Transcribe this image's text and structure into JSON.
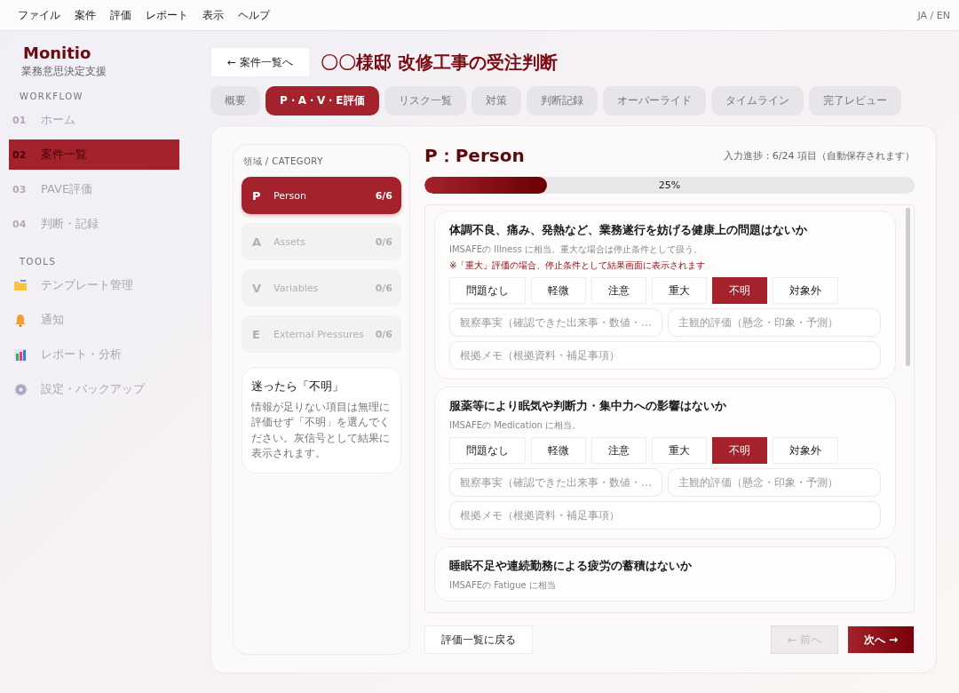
{
  "menu": [
    "ファイル",
    "案件",
    "評価",
    "レポート",
    "表示",
    "ヘルプ"
  ],
  "language_switch": "JA / EN",
  "sidebar": {
    "brand": "Monitio",
    "subtitle": "業務意思決定支援",
    "sections": [
      {
        "title": "WORKFLOW",
        "items": [
          {
            "kind": "numbered",
            "number": "01",
            "label": "ホーム",
            "selected": false
          },
          {
            "kind": "numbered",
            "number": "02",
            "label": "案件一覧",
            "selected": true
          },
          {
            "kind": "numbered",
            "number": "03",
            "label": "PAVE評価",
            "selected": false
          },
          {
            "kind": "numbered",
            "number": "04",
            "label": "判断・記録",
            "selected": false
          }
        ]
      },
      {
        "title": "TOOLS",
        "items": [
          {
            "kind": "icon",
            "label": "テンプレート管理",
            "selected": false
          },
          {
            "kind": "icon",
            "label": "通知",
            "selected": false
          },
          {
            "kind": "icon",
            "label": "レポート・分析",
            "selected": false
          },
          {
            "kind": "icon",
            "label": "設定・バックアップ",
            "selected": false
          }
        ]
      }
    ]
  },
  "back_button": "← 案件一覧へ",
  "title": "〇〇様邸 改修工事の受注判断",
  "tabs": [
    {
      "label": "概要",
      "selected": false
    },
    {
      "label": "P・A・V・E評価",
      "selected": true
    },
    {
      "label": "リスク一覧",
      "selected": false
    },
    {
      "label": "対策",
      "selected": false
    },
    {
      "label": "判断記録",
      "selected": false
    },
    {
      "label": "オーバーライド",
      "selected": false
    },
    {
      "label": "タイムライン",
      "selected": false
    },
    {
      "label": "完了レビュー",
      "selected": false
    }
  ],
  "category_heading": "領域 / CATEGORY",
  "categories": [
    {
      "letter": "P",
      "name": "Person",
      "count": "6/6",
      "selected": true
    },
    {
      "letter": "A",
      "name": "Assets",
      "count": "0/6",
      "selected": false
    },
    {
      "letter": "V",
      "name": "Variables",
      "count": "0/6",
      "selected": false
    },
    {
      "letter": "E",
      "name": "External Pressures",
      "count": "0/6",
      "selected": false
    }
  ],
  "hint": {
    "title": "迷ったら「不明」",
    "text": "情報が足りない項目は無理に評価せず「不明」を選んでください。灰信号として結果に表示されます。"
  },
  "section_title": "P：Person",
  "progress_text": "入力進捗：6/24 項目（自動保存されます）",
  "progress": {
    "level": 0.25,
    "label": "25%"
  },
  "questions": [
    {
      "title": "体調不良、痛み、発熱など、業務遂行を妨げる健康上の問題はないか",
      "note": "IMSAFEの Illness に相当。重大な場合は停止条件として扱う。",
      "warning": "※「重大」評価の場合、停止条件として結果画面に表示されます",
      "options": [
        {
          "label": "問題なし",
          "selected": false
        },
        {
          "label": "軽微",
          "selected": false
        },
        {
          "label": "注意",
          "selected": false
        },
        {
          "label": "重大",
          "selected": false
        },
        {
          "label": "不明",
          "selected": true
        },
        {
          "label": "対象外",
          "selected": false
        }
      ],
      "fields": [
        {
          "placeholder": "観察事実（確認できた出来事・数値・…"
        },
        {
          "placeholder": "主観的評価（懸念・印象・予測）"
        },
        {
          "placeholder": "根拠メモ（根拠資料・補足事項）"
        }
      ]
    },
    {
      "title": "服薬等により眠気や判断力・集中力への影響はないか",
      "note": "IMSAFEの Medication に相当。",
      "options": [
        {
          "label": "問題なし",
          "selected": false
        },
        {
          "label": "軽微",
          "selected": false
        },
        {
          "label": "注意",
          "selected": false
        },
        {
          "label": "重大",
          "selected": false
        },
        {
          "label": "不明",
          "selected": true
        },
        {
          "label": "対象外",
          "selected": false
        }
      ],
      "fields": [
        {
          "placeholder": "観察事実（確認できた出来事・数値・…"
        },
        {
          "placeholder": "主観的評価（懸念・印象・予測）"
        },
        {
          "placeholder": "根拠メモ（根拠資料・補足事項）"
        }
      ]
    },
    {
      "title": "睡眠不足や連続勤務による疲労の蓄積はないか",
      "note": "IMSAFEの Fatigue に相当"
    }
  ],
  "footer": {
    "back": "評価一覧に戻る",
    "prev": {
      "label": "← 前へ",
      "disabled": true
    },
    "next": {
      "label": "次へ →",
      "disabled": false
    }
  }
}
